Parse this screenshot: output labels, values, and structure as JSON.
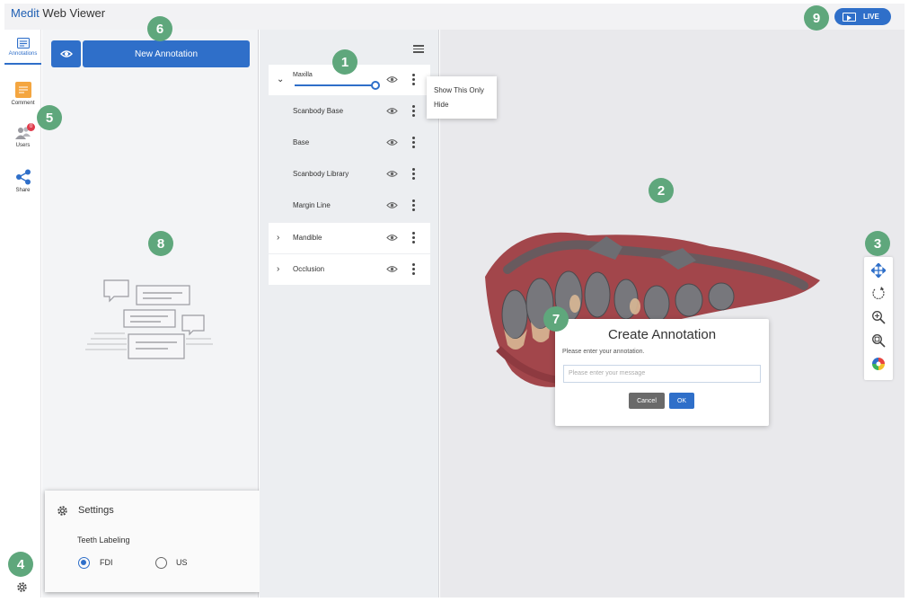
{
  "app": {
    "brand_part1": "Medit",
    "brand_part2": " Web Viewer"
  },
  "live_button": {
    "label": "LIVE"
  },
  "sidebar": {
    "items": [
      {
        "label": "Annotations",
        "icon": "annotations-icon",
        "active": true
      },
      {
        "label": "Comment",
        "icon": "comment-icon"
      },
      {
        "label": "Users",
        "icon": "users-icon",
        "badge": "0"
      },
      {
        "label": "Share",
        "icon": "share-icon"
      }
    ],
    "settings_icon": "gear-icon"
  },
  "annotation_panel": {
    "new_button": "New Annotation"
  },
  "settings_popup": {
    "title": "Settings",
    "teeth_label": "Teeth Labeling",
    "options": [
      {
        "label": "FDI",
        "selected": true
      },
      {
        "label": "US",
        "selected": false
      }
    ]
  },
  "layers": {
    "items": [
      {
        "name": "Maxilla",
        "expanded": true,
        "level": 0
      },
      {
        "name": "Scanbody Base",
        "level": 1
      },
      {
        "name": "Base",
        "level": 1
      },
      {
        "name": "Scanbody Library",
        "level": 1
      },
      {
        "name": "Margin Line",
        "level": 1
      },
      {
        "name": "Mandible",
        "expanded": false,
        "level": 0
      },
      {
        "name": "Occlusion",
        "expanded": false,
        "level": 0
      }
    ],
    "opacity_percent": 100
  },
  "context_menu": {
    "items": [
      "Show This Only",
      "Hide"
    ]
  },
  "tools": [
    "pan-icon",
    "rotate-icon",
    "zoom-in-icon",
    "zoom-fit-icon",
    "color-icon"
  ],
  "dialog": {
    "title": "Create Annotation",
    "subtitle": "Please enter your annotation.",
    "placeholder": "Please enter your message",
    "cancel": "Cancel",
    "ok": "OK"
  },
  "markers": [
    "1",
    "2",
    "3",
    "4",
    "5",
    "6",
    "7",
    "8",
    "9"
  ],
  "colors": {
    "accent": "#2f6fc9",
    "marker": "#5fa77c",
    "badge": "#e03c4c"
  }
}
